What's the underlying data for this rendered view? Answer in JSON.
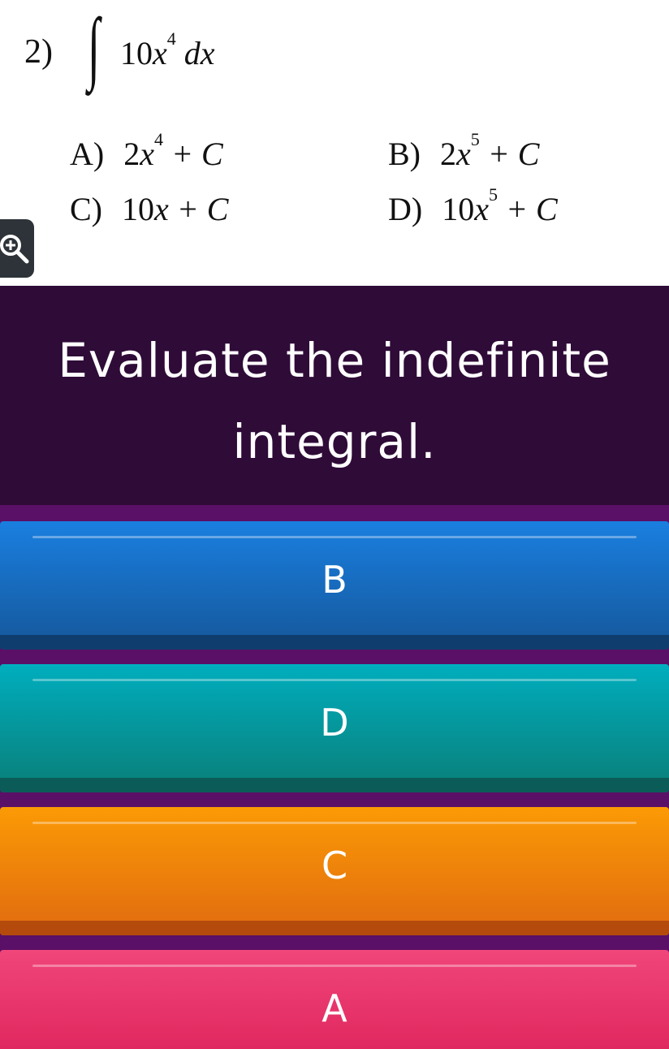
{
  "question_image": {
    "number": "2)",
    "integral": "∫",
    "integrand": {
      "coef": "10",
      "var": "x",
      "exp": "4",
      "diff": "dx"
    },
    "options": [
      {
        "letter": "A)",
        "coef": "2",
        "var": "x",
        "exp": "4",
        "tail": "+ C"
      },
      {
        "letter": "B)",
        "coef": "2",
        "var": "x",
        "exp": "5",
        "tail": "+ C"
      },
      {
        "letter": "C)",
        "coef": "10",
        "var": "x",
        "exp": "",
        "tail": "+ C"
      },
      {
        "letter": "D)",
        "coef": "10",
        "var": "x",
        "exp": "5",
        "tail": "+ C"
      }
    ],
    "zoom_icon": "zoom-in-icon"
  },
  "question": {
    "text_line1": "Evaluate the indefinite",
    "text_line2": "integral."
  },
  "answers": [
    {
      "label": "B",
      "color": "#1a7fe0"
    },
    {
      "label": "D",
      "color": "#00aebe"
    },
    {
      "label": "C",
      "color": "#fb9a05"
    },
    {
      "label": "A",
      "color": "#f0467a"
    }
  ],
  "colors": {
    "page_background": "#5a1066",
    "question_background": "#2f0b38"
  }
}
